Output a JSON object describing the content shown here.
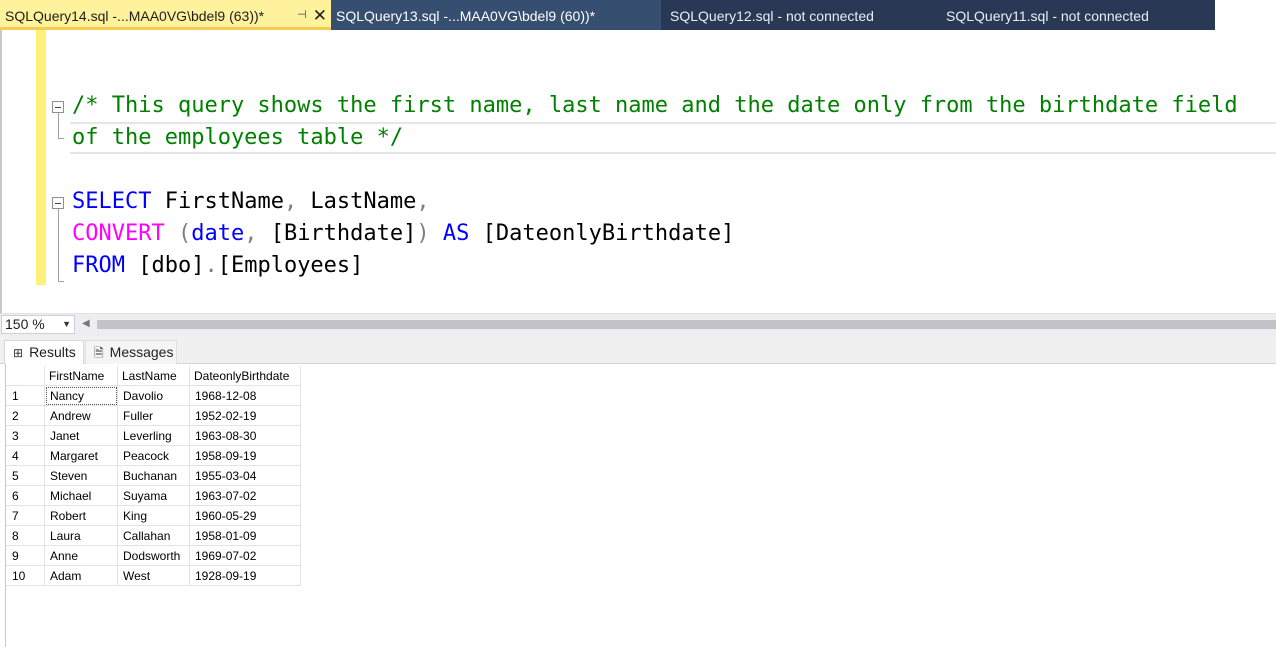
{
  "tabs": [
    {
      "label": "SQLQuery14.sql -...MAA0VG\\bdel9 (63))*",
      "active": true
    },
    {
      "label": "SQLQuery13.sql -...MAA0VG\\bdel9 (60))*",
      "active": false
    },
    {
      "label": "SQLQuery12.sql - not connected",
      "active": false
    },
    {
      "label": "SQLQuery11.sql - not connected",
      "active": false
    }
  ],
  "editor": {
    "comment_line1": "/* This query shows the first name, last name and the date only from the birthdate field",
    "comment_line2": "of the employees table */",
    "select_kw": "SELECT",
    "select_cols_1": " FirstName",
    "comma1": ",",
    "select_cols_2": " LastName",
    "comma2": ",",
    "convert_fn": "CONVERT",
    "paren_open": " (",
    "date_kw": "date",
    "comma3": ",",
    "birthdate_col": " [Birthdate]",
    "paren_close": ")",
    "as_kw": " AS",
    "alias": " [DateonlyBirthdate]",
    "from_kw": "FROM",
    "schema": " [dbo]",
    "dot": ".",
    "table": "[Employees]"
  },
  "zoom": {
    "value": "150 %"
  },
  "result_tabs": {
    "results": "Results",
    "messages": "Messages"
  },
  "grid": {
    "columns": [
      "FirstName",
      "LastName",
      "DateonlyBirthdate"
    ],
    "rows": [
      [
        "1",
        "Nancy",
        "Davolio",
        "1968-12-08"
      ],
      [
        "2",
        "Andrew",
        "Fuller",
        "1952-02-19"
      ],
      [
        "3",
        "Janet",
        "Leverling",
        "1963-08-30"
      ],
      [
        "4",
        "Margaret",
        "Peacock",
        "1958-09-19"
      ],
      [
        "5",
        "Steven",
        "Buchanan",
        "1955-03-04"
      ],
      [
        "6",
        "Michael",
        "Suyama",
        "1963-07-02"
      ],
      [
        "7",
        "Robert",
        "King",
        "1960-05-29"
      ],
      [
        "8",
        "Laura",
        "Callahan",
        "1958-01-09"
      ],
      [
        "9",
        "Anne",
        "Dodsworth",
        "1969-07-02"
      ],
      [
        "10",
        "Adam",
        "West",
        "1928-09-19"
      ]
    ]
  },
  "colors": {
    "active_tab": "#fff29d",
    "tabbar": "#293955",
    "comment": "#008000",
    "keyword": "#0000ff",
    "function": "#ff00ff"
  }
}
